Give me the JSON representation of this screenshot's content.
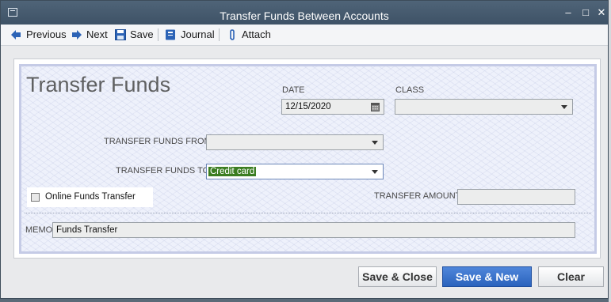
{
  "window": {
    "title": "Transfer Funds Between Accounts"
  },
  "toolbar": {
    "previous": "Previous",
    "next": "Next",
    "save": "Save",
    "journal": "Journal",
    "attach": "Attach"
  },
  "form": {
    "heading": "Transfer Funds",
    "date_label": "DATE",
    "date_value": "12/15/2020",
    "class_label": "CLASS",
    "class_value": "",
    "from_label": "TRANSFER FUNDS FROM",
    "from_value": "",
    "to_label": "TRANSFER FUNDS TO",
    "to_value": "Credit card",
    "online_label": "Online Funds Transfer",
    "online_checked": false,
    "amount_label": "TRANSFER AMOUNT",
    "amount_value": "",
    "memo_label": "MEMO",
    "memo_value": "Funds Transfer"
  },
  "buttons": {
    "save_close": "Save & Close",
    "save_new": "Save & New",
    "clear": "Clear"
  },
  "icons": {
    "previous": "arrow-left-icon",
    "next": "arrow-right-icon",
    "save": "floppy-disk-icon",
    "journal": "journal-icon",
    "attach": "paperclip-icon",
    "date_picker": "calendar-icon"
  },
  "colors": {
    "accent": "#2a63bd",
    "selection": "#3b7d21",
    "titlebar": "#45596d"
  }
}
